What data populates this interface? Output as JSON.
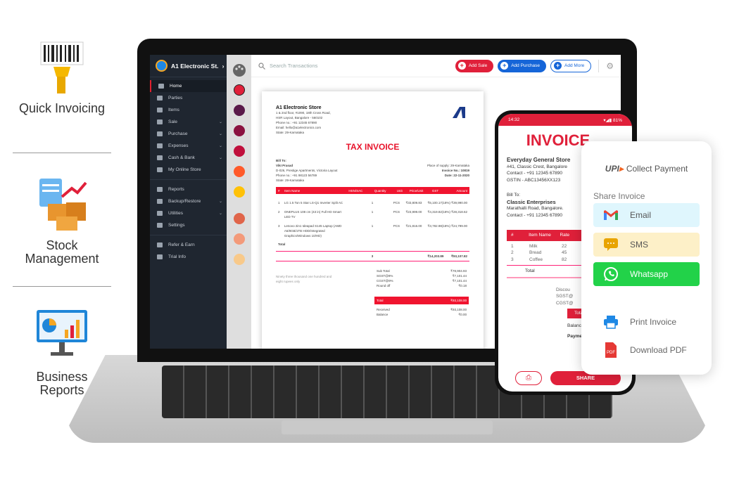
{
  "features": [
    {
      "label": "Quick Invoicing",
      "icon": "barcode-scanner-icon"
    },
    {
      "label": "Stock Management",
      "icon": "inventory-boxes-icon"
    },
    {
      "label": "Business Reports",
      "icon": "report-chart-icon"
    }
  ],
  "app": {
    "store_name": "A1 Electronic St.",
    "search_placeholder": "Search Transactions",
    "buttons": {
      "add_sale": "Add Sale",
      "add_purchase": "Add Purchase",
      "add_more": "Add More"
    },
    "sidebar": [
      {
        "label": "Home",
        "active": true
      },
      {
        "label": "Parties"
      },
      {
        "label": "Items"
      },
      {
        "label": "Sale",
        "chev": true
      },
      {
        "label": "Purchase",
        "chev": true
      },
      {
        "label": "Expenses",
        "chev": true
      },
      {
        "label": "Cash & Bank",
        "chev": true
      },
      {
        "label": "My Online Store"
      },
      {
        "label": "Reports"
      },
      {
        "label": "Backup/Restore",
        "chev": true
      },
      {
        "label": "Utilities",
        "chev": true
      },
      {
        "label": "Settings"
      },
      {
        "label": "Refer & Earn"
      },
      {
        "label": "Trial Info"
      }
    ],
    "palette_colors": [
      "#e0203a",
      "#5a1a4a",
      "#8b1240",
      "#c0103c",
      "#ff5a2a",
      "#ffc107",
      "#e0654a",
      "#f39a7a",
      "#f8c98a"
    ]
  },
  "invoice": {
    "store": "A1 Electronic Store",
    "address1": "1 & 2nd floor, #1090, 18th Cross Road,",
    "address2": "HSR Layout, Bangalore - 560102",
    "phone": "Phone no.: +91 12345 67890",
    "email": "Email: hello@a1electronics.com",
    "state": "State: 29-Karnataka",
    "title": "TAX INVOICE",
    "bill_to_label": "Bill To:",
    "customer": "VikI Prasad",
    "cust_address": "D-026, Prestige Apartments, Victoria Layout",
    "cust_phone": "Phone no.: +91 98123 56789",
    "cust_state": "State: 29-Karnataka",
    "place": "Place of supply: 29-Karnataka",
    "invoice_no": "Invoice No.: 10819",
    "date": "Date: 22-11-2020",
    "columns": [
      "#",
      "Item Name",
      "HSN/SAC",
      "Quantity",
      "Unit",
      "Price/Unit",
      "GST",
      "Amount"
    ],
    "rows": [
      [
        "1",
        "LG 1.5 Ton 5 Star LS-Q1 Inverter Split AC",
        "",
        "1",
        "PCS",
        "₹33,809.83",
        "₹6,100.17(18%)",
        "₹39,990.00"
      ],
      [
        "2",
        "ONEPLUS 108 cm (43 in) Full HD Smart LED TV",
        "",
        "1",
        "PCS",
        "₹23,999.00",
        "₹4,319.82(18%)",
        "₹28,318.62"
      ],
      [
        "3",
        "Lenovo 2in1 Ideapad S145 Laptop (AMD A6/8GB/1TB HDD/Integrated Graphics/Windows 10/HD)",
        "",
        "1",
        "PCS",
        "₹21,816.00",
        "₹3,782.98(18%)",
        "₹24,799.00"
      ]
    ],
    "total_label": "Total",
    "total_qty": "3",
    "total_gst": "₹14,203.89",
    "total_amount": "₹93,107.82",
    "in_words": "Ninety three thousand one hundred and eight rupees only",
    "summary": [
      [
        "Sub Total",
        "₹78,904.93"
      ],
      [
        "SGST@9%",
        "₹7,101.44"
      ],
      [
        "CGST@9%",
        "₹7,101.44"
      ],
      [
        "Round off",
        "₹0.18"
      ]
    ],
    "grand": [
      "Total",
      "₹93,108.00"
    ],
    "received": [
      "Received",
      "₹93,108.00"
    ],
    "balance": [
      "Balance",
      "₹0.00"
    ]
  },
  "phone": {
    "time": "14:32",
    "battery": "81%",
    "title": "INVOICE",
    "store": "Everyday General Store",
    "addr": "#41, Classic Crest, Bangalore",
    "contact": "Contact - +91 12345 67890",
    "gstin": "GSTIN - ABC13456XX123",
    "bill_to": "Bill To:",
    "customer": "Classic Enterprises",
    "cust_addr": "Marathalli Road, Bangalore.",
    "cust_contact": "Contact - +91 12345 67890",
    "columns": [
      "#",
      "Item Name",
      "Rate"
    ],
    "rows": [
      [
        "1",
        "Milk",
        "22"
      ],
      [
        "2",
        "Bread",
        "45"
      ],
      [
        "3",
        "Coffee",
        "82"
      ]
    ],
    "total": "Total",
    "discount": "Discou",
    "sgst": "SGST@",
    "cgst": "CGST@",
    "total2": "Total",
    "balance": "Balance",
    "payment": "Paymen",
    "share": "SHARE"
  },
  "share_card": {
    "upi_logo": "UPI",
    "collect": "Collect Payment",
    "heading": "Share Invoice",
    "email": "Email",
    "sms": "SMS",
    "whatsapp": "Whatsapp",
    "print": "Print Invoice",
    "pdf": "Download PDF",
    "colors": {
      "email_bg": "#dff6fd",
      "sms_bg": "#fdf0c8",
      "whatsapp_bg": "#22d249"
    }
  },
  "colors": {
    "accent_red": "#e0203a",
    "blue": "#1565d8"
  }
}
